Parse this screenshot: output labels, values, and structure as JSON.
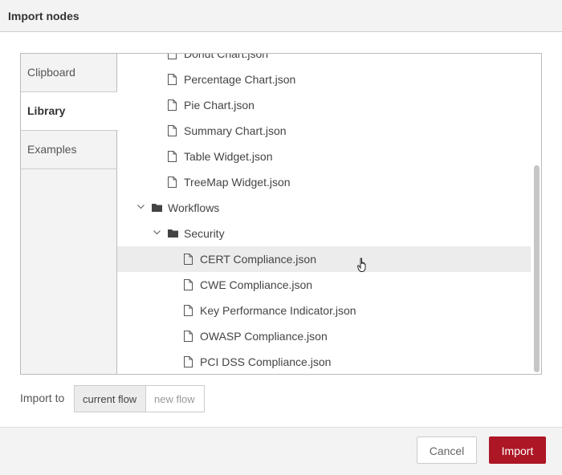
{
  "dialog": {
    "title": "Import nodes"
  },
  "tabs": [
    {
      "label": "Clipboard"
    },
    {
      "label": "Library"
    },
    {
      "label": "Examples"
    }
  ],
  "tree": {
    "items": [
      {
        "label": "Donut Chart.json",
        "type": "file"
      },
      {
        "label": "Percentage Chart.json",
        "type": "file"
      },
      {
        "label": "Pie Chart.json",
        "type": "file"
      },
      {
        "label": "Summary Chart.json",
        "type": "file"
      },
      {
        "label": "Table Widget.json",
        "type": "file"
      },
      {
        "label": "TreeMap Widget.json",
        "type": "file"
      },
      {
        "label": "Workflows",
        "type": "folder"
      },
      {
        "label": "Security",
        "type": "folder"
      },
      {
        "label": "CERT Compliance.json",
        "type": "file"
      },
      {
        "label": "CWE Compliance.json",
        "type": "file"
      },
      {
        "label": "Key Performance Indicator.json",
        "type": "file"
      },
      {
        "label": "OWASP Compliance.json",
        "type": "file"
      },
      {
        "label": "PCI DSS Compliance.json",
        "type": "file"
      }
    ]
  },
  "import_to": {
    "label": "Import to",
    "options": [
      "current flow",
      "new flow"
    ],
    "selected": "current flow"
  },
  "buttons": {
    "cancel": "Cancel",
    "import": "Import"
  },
  "colors": {
    "primary": "#ad1625",
    "selected_row": "#ececec"
  }
}
